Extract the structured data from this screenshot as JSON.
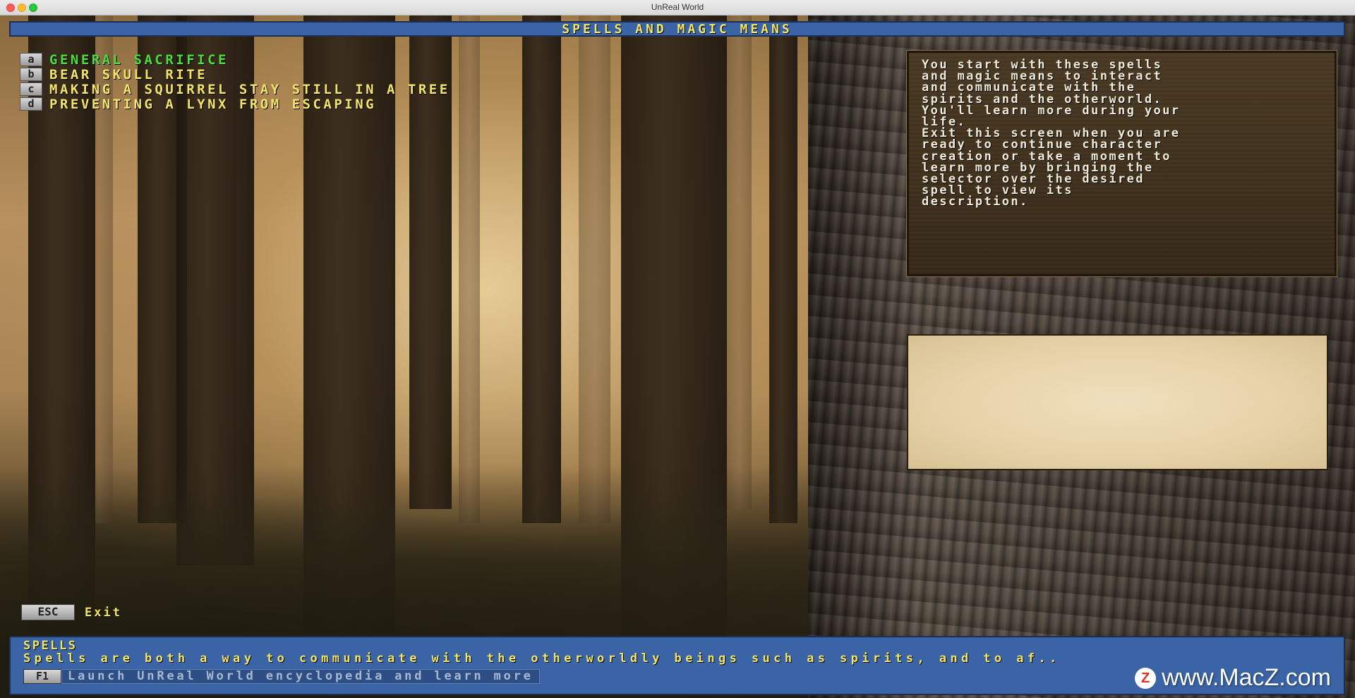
{
  "window": {
    "title": "UnReal World"
  },
  "header": {
    "title": "SPELLS AND MAGIC MEANS"
  },
  "spells": [
    {
      "key": "a",
      "name": "GENERAL SACRIFICE",
      "selected": true
    },
    {
      "key": "b",
      "name": "BEAR SKULL RITE",
      "selected": false
    },
    {
      "key": "c",
      "name": "MAKING A SQUIRREL STAY STILL IN A TREE",
      "selected": false
    },
    {
      "key": "d",
      "name": "PREVENTING A LYNX FROM ESCAPING",
      "selected": false
    }
  ],
  "info_panel": {
    "lines": [
      "You start with these spells",
      "and magic means to interact",
      "and communicate with the",
      "spirits and the otherworld.",
      "You'll learn more during your",
      "life.",
      "Exit this screen when you are",
      "ready to continue character",
      "creation or take a moment to",
      "learn more by bringing the",
      "selector over the desired",
      "spell to view its",
      "description."
    ]
  },
  "exit": {
    "key": "ESC",
    "label": "Exit"
  },
  "bottom": {
    "title": "SPELLS",
    "description": "Spells are both a way to communicate with the otherworldly beings such as spirits, and to af..",
    "f1_key": "F1",
    "f1_label": "Launch UnReal World encyclopedia and learn more"
  },
  "watermark": {
    "logo": "Z",
    "text": "www.MacZ.com"
  },
  "colors": {
    "header_bg": "#3a64a6",
    "text_yellow": "#f2e46a",
    "selected_green": "#4cdc3c"
  }
}
